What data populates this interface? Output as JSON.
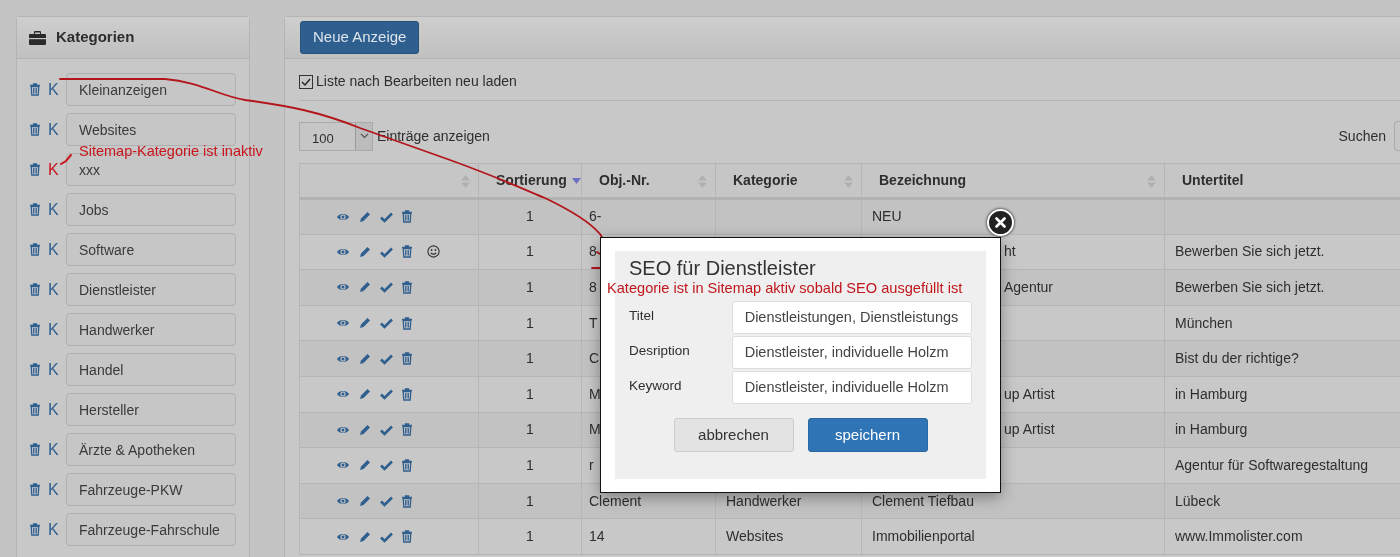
{
  "sidebar": {
    "title": "Kategorien",
    "categories": [
      {
        "name": "Kleinanzeigen",
        "key": "K",
        "sitemap_active": true
      },
      {
        "name": "Websites",
        "key": "K",
        "sitemap_active": true
      },
      {
        "name": "xxx",
        "key": "K",
        "sitemap_active": false
      },
      {
        "name": "Jobs",
        "key": "K",
        "sitemap_active": true
      },
      {
        "name": "Software",
        "key": "K",
        "sitemap_active": true
      },
      {
        "name": "Dienstleister",
        "key": "K",
        "sitemap_active": true
      },
      {
        "name": "Handwerker",
        "key": "K",
        "sitemap_active": true
      },
      {
        "name": "Handel",
        "key": "K",
        "sitemap_active": true
      },
      {
        "name": "Hersteller",
        "key": "K",
        "sitemap_active": true
      },
      {
        "name": "Ärzte & Apotheken",
        "key": "K",
        "sitemap_active": true
      },
      {
        "name": "Fahrzeuge-PKW",
        "key": "K",
        "sitemap_active": true
      },
      {
        "name": "Fahrzeuge-Fahrschule",
        "key": "K",
        "sitemap_active": true
      }
    ]
  },
  "toolbar": {
    "new_button": "Neue Anzeige",
    "reload_checkbox": {
      "label": "Liste nach Bearbeiten neu laden",
      "checked": true
    },
    "page_size": {
      "value": "100",
      "label": "Einträge anzeigen"
    },
    "search_label": "Suchen"
  },
  "table": {
    "columns": [
      {
        "sorted": false
      },
      {
        "label": "Sortierung",
        "sorted": true
      },
      {
        "label": "Obj.-Nr.",
        "sorted": false
      },
      {
        "label": "Kategorie",
        "sorted": false
      },
      {
        "label": "Bezeichnung",
        "sorted": false
      },
      {
        "label": "Untertitel"
      }
    ],
    "rows": [
      {
        "smiley": false,
        "sortierung": "1",
        "obj_nr": "6-",
        "bezeichnung": "NEU"
      },
      {
        "smiley": true,
        "sortierung": "1",
        "obj_nr": "8",
        "bezeichnung": "ht",
        "covered": true,
        "untertitel": "Bewerben Sie sich jetzt."
      },
      {
        "smiley": false,
        "sortierung": "1",
        "obj_nr": "8",
        "bezeichnung": "Agentur",
        "covered": true,
        "untertitel": "Bewerben Sie sich jetzt."
      },
      {
        "smiley": false,
        "sortierung": "1",
        "obj_nr": "T",
        "untertitel": "München"
      },
      {
        "smiley": false,
        "sortierung": "1",
        "obj_nr": "C",
        "untertitel": "Bist du der richtige?"
      },
      {
        "smiley": false,
        "sortierung": "1",
        "obj_nr": "M",
        "bezeichnung": "up Artist",
        "covered": true,
        "untertitel": "in Hamburg"
      },
      {
        "smiley": false,
        "sortierung": "1",
        "obj_nr": "M",
        "bezeichnung": "up Artist",
        "covered": true,
        "untertitel": "in Hamburg"
      },
      {
        "smiley": false,
        "sortierung": "1",
        "obj_nr": "r",
        "untertitel": "Agentur für Softwaregestaltung"
      },
      {
        "smiley": false,
        "sortierung": "1",
        "obj_nr": "Clement",
        "kategorie": "Handwerker",
        "bezeichnung": "Clement Tiefbau",
        "untertitel": "Lübeck"
      },
      {
        "smiley": false,
        "sortierung": "1",
        "obj_nr": "14",
        "kategorie": "Websites",
        "bezeichnung": "Immobilienportal",
        "untertitel": "www.Immolister.com"
      }
    ]
  },
  "modal": {
    "title": "SEO für Dienstleister",
    "note": "Kategorie ist in Sitemap aktiv sobald SEO ausgefüllt ist",
    "fields": [
      {
        "label": "Titel",
        "value": "Dienstleistungen, Dienstleistungs"
      },
      {
        "label": "Desription",
        "value": "Dienstleister, individuelle Holzm"
      },
      {
        "label": "Keyword",
        "value": "Dienstleister, individuelle Holzm"
      }
    ],
    "buttons": [
      {
        "label": "abbrechen",
        "kind": "secondary"
      },
      {
        "label": "speichern",
        "kind": "primary"
      }
    ]
  },
  "annotations": {
    "sidebar_note": "Sitemap-Kategorie ist inaktiv"
  }
}
